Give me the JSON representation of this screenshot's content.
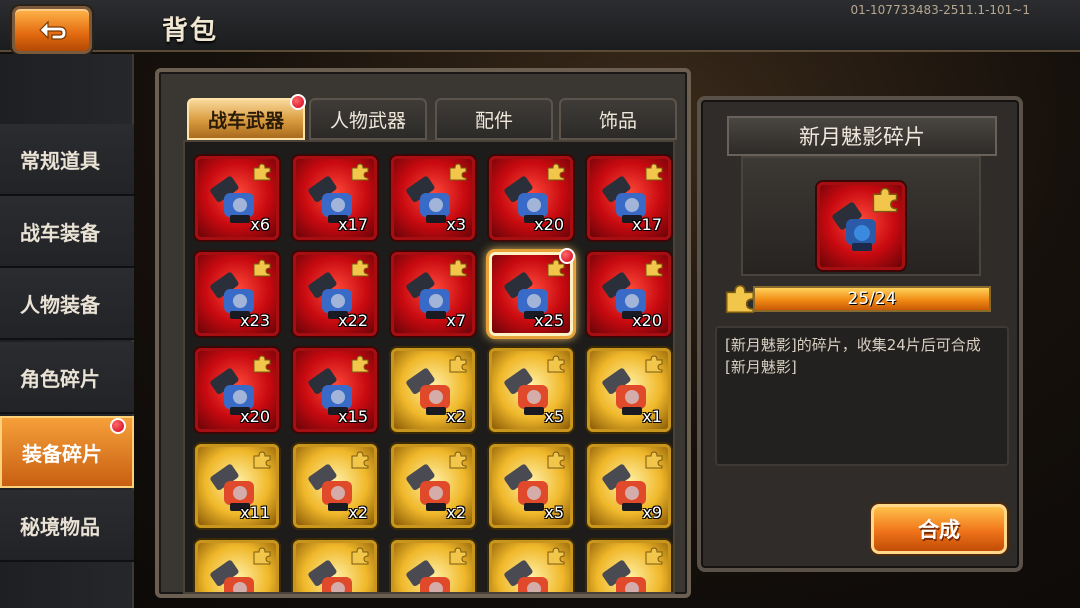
{
  "header": {
    "title": "背包",
    "build": "01-107733483-2511.1-101~1"
  },
  "sidebar": {
    "items": [
      {
        "label": "常规道具",
        "active": false
      },
      {
        "label": "战车装备",
        "active": false
      },
      {
        "label": "人物装备",
        "active": false
      },
      {
        "label": "角色碎片",
        "active": false
      },
      {
        "label": "装备碎片",
        "active": true,
        "badge": true
      },
      {
        "label": "秘境物品",
        "active": false
      }
    ]
  },
  "tabs": [
    {
      "label": "战车武器",
      "active": true,
      "badge": true
    },
    {
      "label": "人物武器",
      "active": false
    },
    {
      "label": "配件",
      "active": false
    },
    {
      "label": "饰品",
      "active": false
    }
  ],
  "items": [
    {
      "qty": "x6",
      "rarity": "red",
      "icon": "cannon-fragment-icon"
    },
    {
      "qty": "x17",
      "rarity": "red",
      "icon": "cannon-fragment-icon"
    },
    {
      "qty": "x3",
      "rarity": "red",
      "icon": "cannon-fragment-icon"
    },
    {
      "qty": "x20",
      "rarity": "red",
      "icon": "gatling-fragment-icon"
    },
    {
      "qty": "x17",
      "rarity": "red",
      "icon": "cannon-fragment-icon"
    },
    {
      "qty": "x23",
      "rarity": "red",
      "icon": "rifle-fragment-icon"
    },
    {
      "qty": "x22",
      "rarity": "red",
      "icon": "launcher-fragment-icon"
    },
    {
      "qty": "x7",
      "rarity": "red",
      "icon": "claw-fragment-icon"
    },
    {
      "qty": "x25",
      "rarity": "red",
      "icon": "cannon-fragment-icon",
      "selected": true,
      "badge": true
    },
    {
      "qty": "x20",
      "rarity": "red",
      "icon": "mech-fragment-icon"
    },
    {
      "qty": "x20",
      "rarity": "red",
      "icon": "beast-fragment-icon"
    },
    {
      "qty": "x15",
      "rarity": "red",
      "icon": "dragon-fragment-icon"
    },
    {
      "qty": "x2",
      "rarity": "gold",
      "icon": "turret-fragment-icon"
    },
    {
      "qty": "x5",
      "rarity": "gold",
      "icon": "laser-fragment-icon"
    },
    {
      "qty": "x1",
      "rarity": "gold",
      "icon": "box-launcher-fragment-icon"
    },
    {
      "qty": "x11",
      "rarity": "gold",
      "icon": "pod-fragment-icon"
    },
    {
      "qty": "x2",
      "rarity": "gold",
      "icon": "missile-pod-fragment-icon"
    },
    {
      "qty": "x2",
      "rarity": "gold",
      "icon": "shield-fragment-icon"
    },
    {
      "qty": "x5",
      "rarity": "gold",
      "icon": "rail-fragment-icon"
    },
    {
      "qty": "x9",
      "rarity": "gold",
      "icon": "saw-fragment-icon"
    },
    {
      "qty": "",
      "rarity": "gold",
      "icon": "gun-fragment-icon"
    },
    {
      "qty": "",
      "rarity": "gold",
      "icon": "gun-fragment-icon"
    },
    {
      "qty": "",
      "rarity": "gold",
      "icon": "gun-fragment-icon"
    },
    {
      "qty": "",
      "rarity": "gold",
      "icon": "gun-fragment-icon"
    },
    {
      "qty": "",
      "rarity": "gold",
      "icon": "gun-fragment-icon"
    }
  ],
  "detail": {
    "title": "新月魅影碎片",
    "progress_text": "25/24",
    "progress_value": 1.0,
    "description": "[新月魅影]的碎片，收集24片后可合成[新月魅影]",
    "combine_label": "合成"
  },
  "colors": {
    "accent": "#f0741a",
    "red_rarity": "#c80a10",
    "gold_rarity": "#f0b82a",
    "badge": "#d0001a"
  }
}
